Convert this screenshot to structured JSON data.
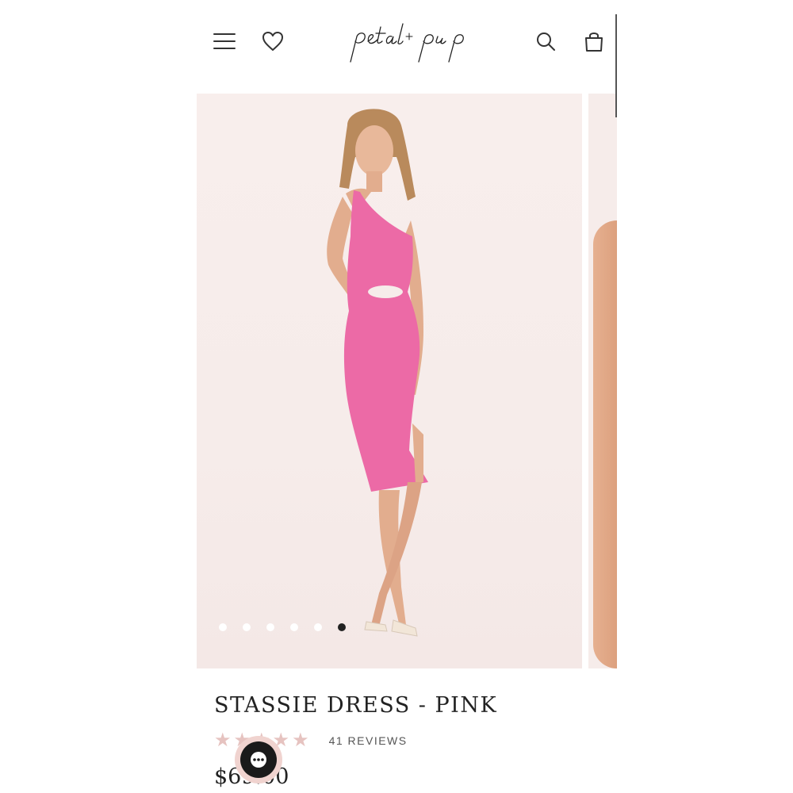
{
  "header": {
    "menu_icon": "hamburger-menu-icon",
    "wishlist_icon": "heart-icon",
    "logo_text": "petal + pup",
    "search_icon": "search-icon",
    "bag_icon": "shopping-bag-icon"
  },
  "gallery": {
    "slide_count": 6,
    "active_slide": 6
  },
  "product": {
    "title": "STASSIE DRESS - PINK",
    "rating": 5,
    "reviews_label": "41 REVIEWS",
    "price": "$69.00"
  },
  "chat": {
    "icon": "chat-ellipsis-icon"
  },
  "colors": {
    "dress": "#ec6aa6",
    "star": "#e6c3c0",
    "chat_ring": "#f0d3cf"
  }
}
